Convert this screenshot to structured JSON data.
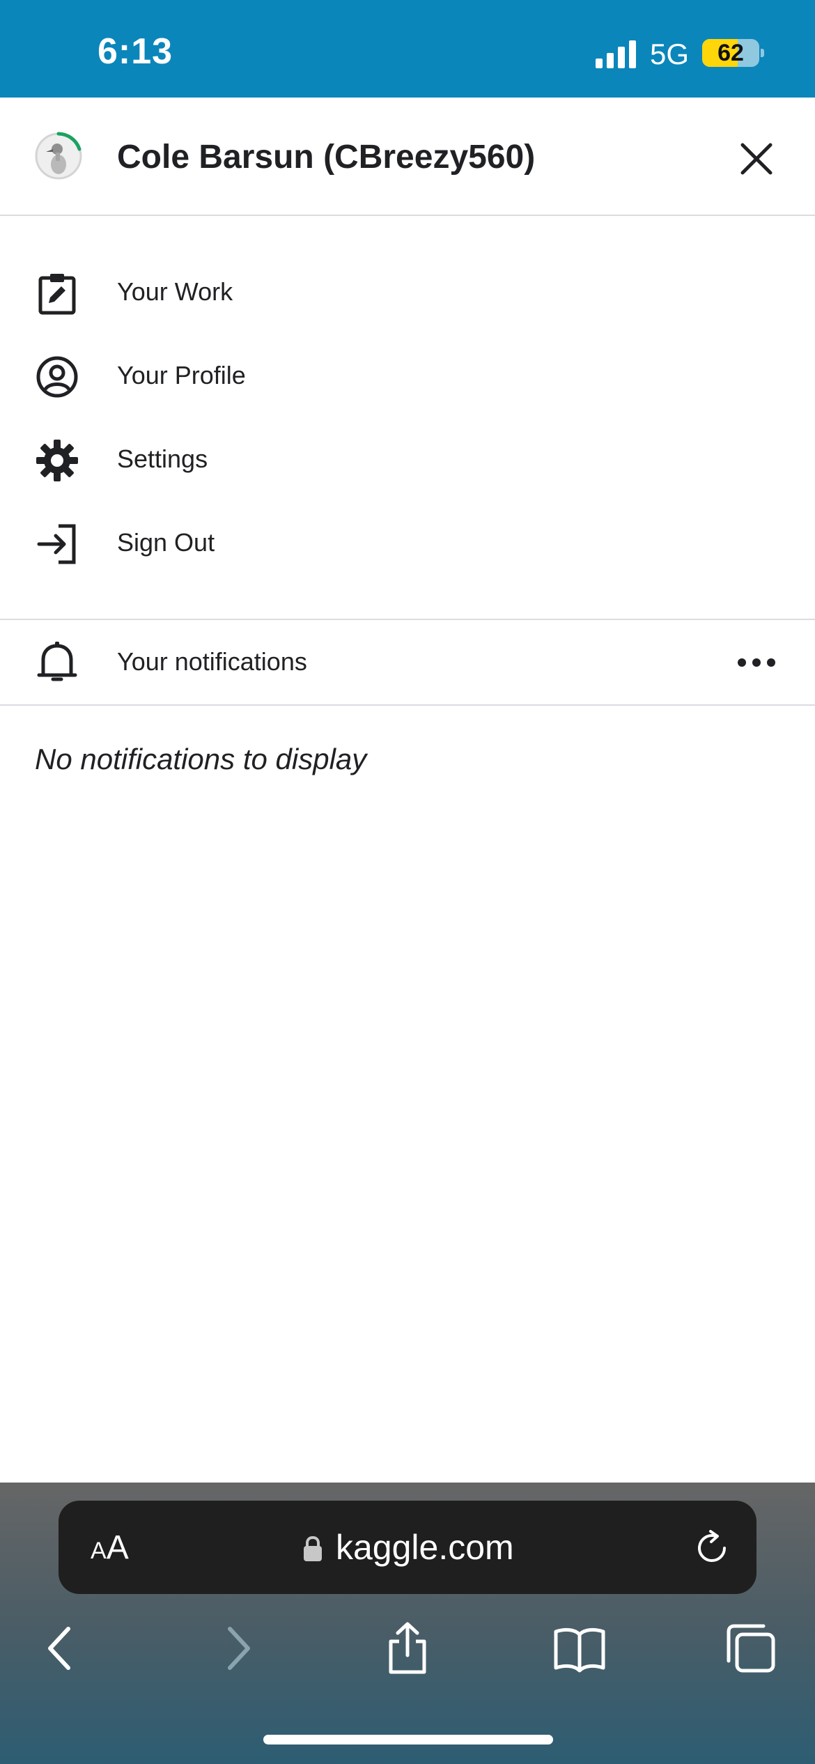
{
  "status_bar": {
    "time": "6:13",
    "network": "5G",
    "battery_level": "62",
    "battery_fraction": 0.62,
    "signal_bars_active": 4
  },
  "drawer": {
    "user_name": "Cole Barsun (CBreezy560)",
    "avatar_icon": "goose-avatar-icon",
    "progress_ring_color": "#20beff",
    "close_icon": "close-icon"
  },
  "menu": {
    "items": [
      {
        "label": "Your Work",
        "icon": "clipboard-edit-icon"
      },
      {
        "label": "Your Profile",
        "icon": "account-circle-icon"
      },
      {
        "label": "Settings",
        "icon": "gear-icon"
      },
      {
        "label": "Sign Out",
        "icon": "sign-out-icon"
      }
    ]
  },
  "notifications": {
    "title": "Your notifications",
    "icon": "bell-icon",
    "more_icon": "more-horizontal-icon",
    "empty_message": "No notifications to display"
  },
  "browser": {
    "text_size_small": "A",
    "text_size_large": "A",
    "url": "kaggle.com",
    "toolbar": [
      "back-icon",
      "forward-icon",
      "share-icon",
      "bookmarks-icon",
      "tabs-icon"
    ]
  },
  "colors": {
    "status_bar_bg": "#0a86bb",
    "battery_fill": "#ffd60a",
    "text_primary": "#202124",
    "divider": "#dadce0",
    "progress_ring": "#20beff"
  }
}
